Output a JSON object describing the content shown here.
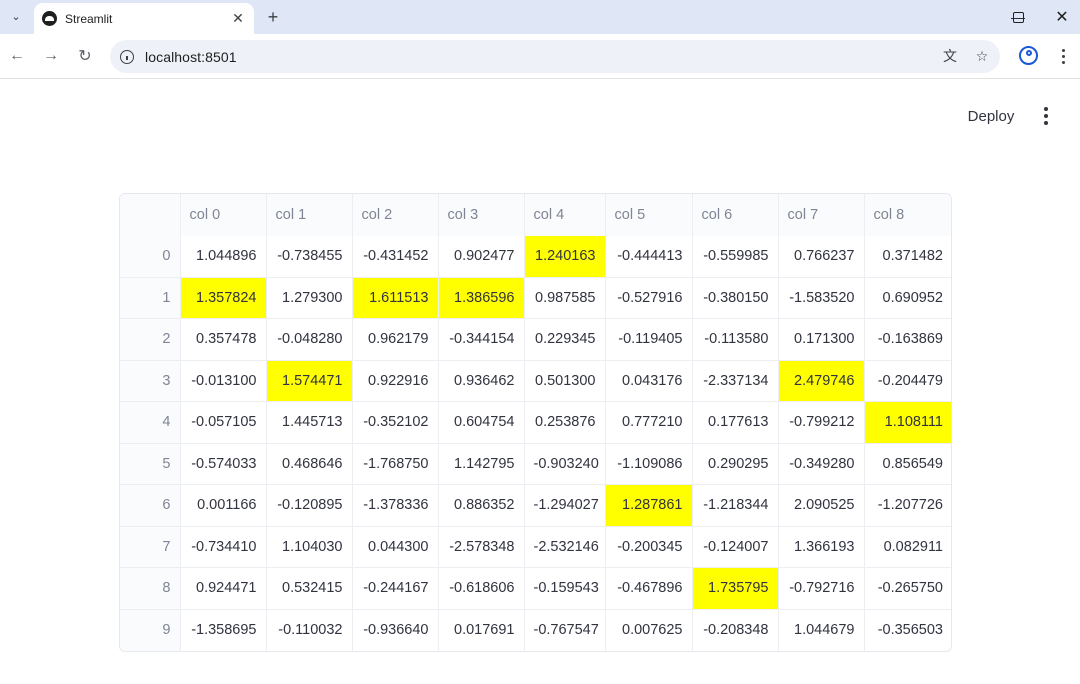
{
  "browser": {
    "tab_title": "Streamlit",
    "url": "localhost:8501",
    "tab_menu_icon": "chevron-down-icon",
    "new_tab_icon": "plus-icon"
  },
  "app": {
    "deploy_label": "Deploy"
  },
  "dataframe": {
    "highlight_color": "#ffff00",
    "columns": [
      "",
      "col 0",
      "col 1",
      "col 2",
      "col 3",
      "col 4",
      "col 5",
      "col 6",
      "col 7",
      "col 8"
    ],
    "rows": [
      {
        "index": "0",
        "cells": [
          "1.044896",
          "-0.738455",
          "-0.431452",
          "0.902477",
          "1.240163",
          "-0.444413",
          "-0.559985",
          "0.766237",
          "0.371482"
        ],
        "highlight": [
          4
        ]
      },
      {
        "index": "1",
        "cells": [
          "1.357824",
          "1.279300",
          "1.611513",
          "1.386596",
          "0.987585",
          "-0.527916",
          "-0.380150",
          "-1.583520",
          "0.690952"
        ],
        "highlight": [
          0,
          2,
          3
        ]
      },
      {
        "index": "2",
        "cells": [
          "0.357478",
          "-0.048280",
          "0.962179",
          "-0.344154",
          "0.229345",
          "-0.119405",
          "-0.113580",
          "0.171300",
          "-0.163869"
        ],
        "highlight": []
      },
      {
        "index": "3",
        "cells": [
          "-0.013100",
          "1.574471",
          "0.922916",
          "0.936462",
          "0.501300",
          "0.043176",
          "-2.337134",
          "2.479746",
          "-0.204479"
        ],
        "highlight": [
          1,
          7
        ]
      },
      {
        "index": "4",
        "cells": [
          "-0.057105",
          "1.445713",
          "-0.352102",
          "0.604754",
          "0.253876",
          "0.777210",
          "0.177613",
          "-0.799212",
          "1.108111"
        ],
        "highlight": [
          8
        ]
      },
      {
        "index": "5",
        "cells": [
          "-0.574033",
          "0.468646",
          "-1.768750",
          "1.142795",
          "-0.903240",
          "-1.109086",
          "0.290295",
          "-0.349280",
          "0.856549"
        ],
        "highlight": []
      },
      {
        "index": "6",
        "cells": [
          "0.001166",
          "-0.120895",
          "-1.378336",
          "0.886352",
          "-1.294027",
          "1.287861",
          "-1.218344",
          "2.090525",
          "-1.207726"
        ],
        "highlight": [
          5
        ]
      },
      {
        "index": "7",
        "cells": [
          "-0.734410",
          "1.104030",
          "0.044300",
          "-2.578348",
          "-2.532146",
          "-0.200345",
          "-0.124007",
          "1.366193",
          "0.082911"
        ],
        "highlight": []
      },
      {
        "index": "8",
        "cells": [
          "0.924471",
          "0.532415",
          "-0.244167",
          "-0.618606",
          "-0.159543",
          "-0.467896",
          "1.735795",
          "-0.792716",
          "-0.265750"
        ],
        "highlight": [
          6
        ]
      },
      {
        "index": "9",
        "cells": [
          "-1.358695",
          "-0.110032",
          "-0.936640",
          "0.017691",
          "-0.767547",
          "0.007625",
          "-0.208348",
          "1.044679",
          "-0.356503"
        ],
        "highlight": []
      }
    ]
  }
}
